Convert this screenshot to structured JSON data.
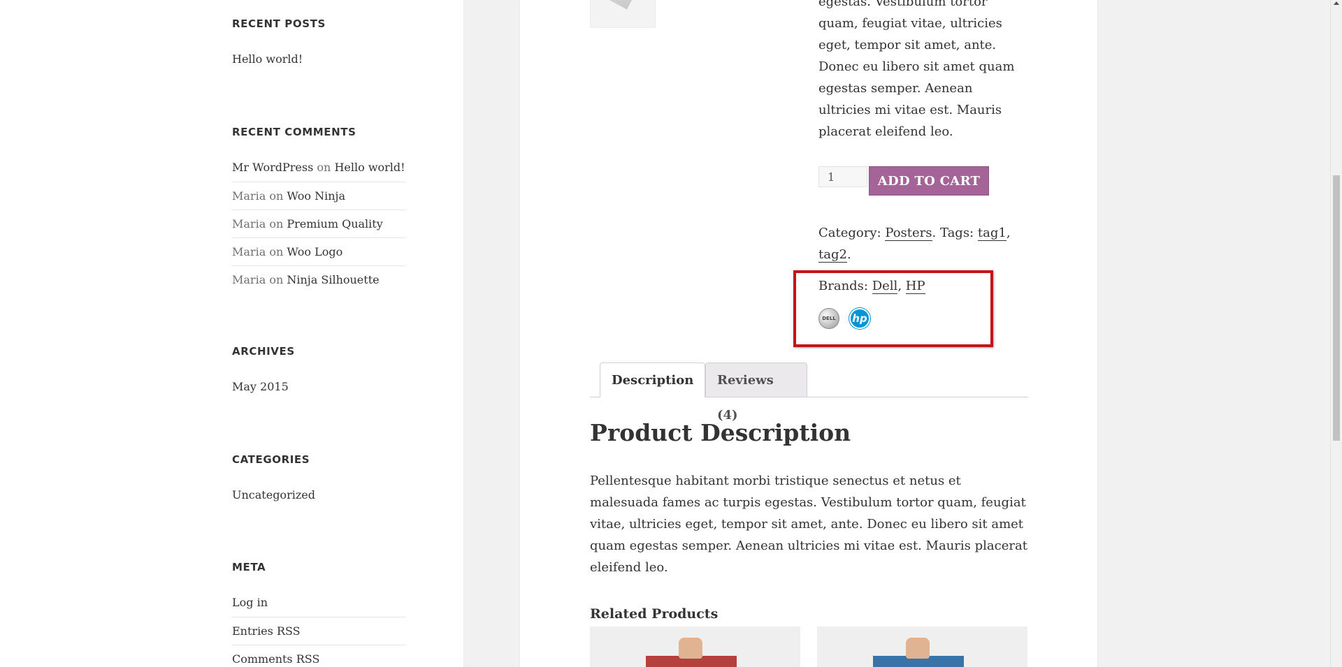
{
  "sidebar": {
    "recent_posts": {
      "title": "RECENT POSTS",
      "items": [
        "Hello world!"
      ]
    },
    "recent_comments": {
      "title": "RECENT COMMENTS",
      "items": [
        {
          "author": "Mr WordPress",
          "on": "on",
          "post": "Hello world!"
        },
        {
          "author": "Maria",
          "on": "on",
          "post": "Woo Ninja"
        },
        {
          "author": "Maria",
          "on": "on",
          "post": "Premium Quality"
        },
        {
          "author": "Maria",
          "on": "on",
          "post": "Woo Logo"
        },
        {
          "author": "Maria",
          "on": "on",
          "post": "Ninja Silhouette"
        }
      ]
    },
    "archives": {
      "title": "ARCHIVES",
      "items": [
        "May 2015"
      ]
    },
    "categories": {
      "title": "CATEGORIES",
      "items": [
        "Uncategorized"
      ]
    },
    "meta": {
      "title": "META",
      "items": [
        "Log in",
        "Entries RSS",
        "Comments RSS"
      ]
    }
  },
  "product": {
    "short_description": "egestas. Vestibulum tortor quam, feugiat vitae, ultricies eget, tempor sit amet, ante. Donec eu libero sit amet quam egestas semper. Aenean ultricies mi vitae est. Mauris placerat eleifend leo.",
    "quantity": "1",
    "add_to_cart": "ADD TO CART",
    "category_label": "Category:",
    "category": "Posters",
    "tags_label": ". Tags:",
    "tags": [
      "tag1",
      "tag2"
    ],
    "brands_label": "Brands:",
    "brands": [
      "Dell",
      "HP"
    ],
    "brand_logo_text": {
      "dell": "DELL",
      "hp": "hp"
    }
  },
  "tabs": {
    "description": "Description",
    "reviews": "Reviews (4)"
  },
  "description": {
    "title": "Product Description",
    "body": "Pellentesque habitant morbi tristique senectus et netus et malesuada fames ac turpis egestas. Vestibulum tortor quam, feugiat vitae, ultricies eget, tempor sit amet, ante. Donec eu libero sit amet quam egestas semper. Aenean ultricies mi vitae est. Mauris placerat eleifend leo."
  },
  "related": {
    "title": "Related Products"
  },
  "colors": {
    "accent": "#a46497",
    "highlight_border": "#c2141a",
    "hp_blue": "#0096d6"
  }
}
